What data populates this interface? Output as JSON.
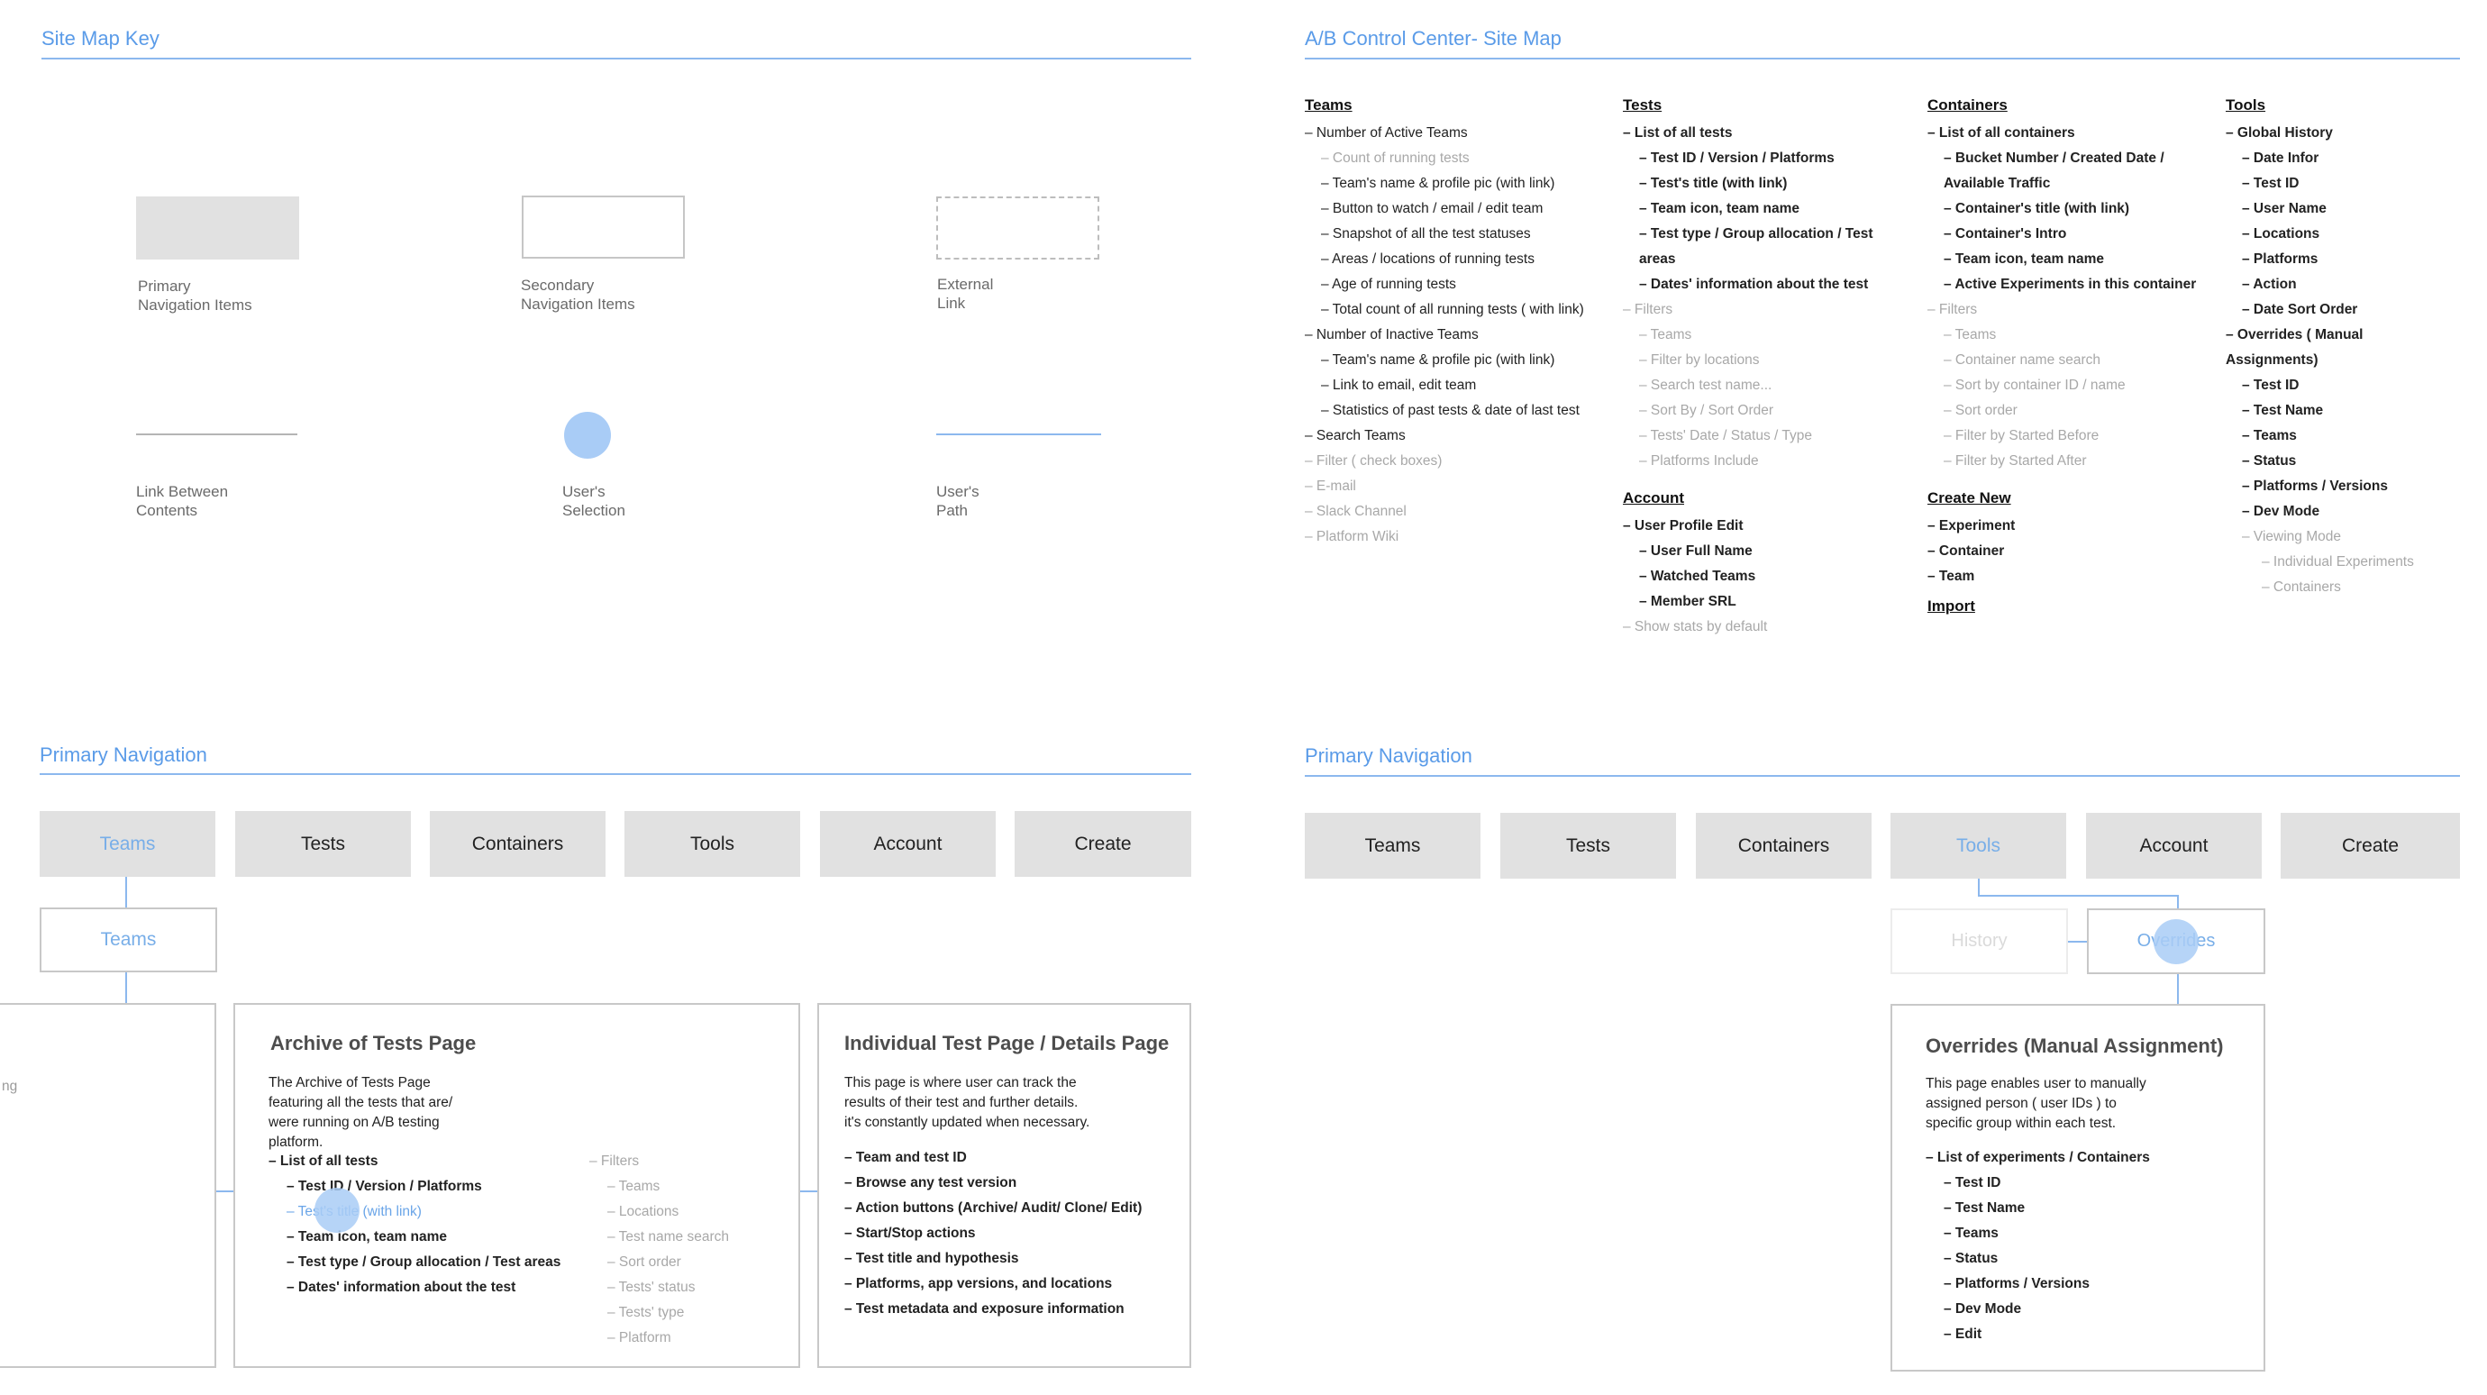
{
  "key": {
    "title": "Site Map Key",
    "primary_l1": "Primary",
    "primary_l2": "Navigation Items",
    "secondary_l1": "Secondary",
    "secondary_l2": "Navigation Items",
    "external_l1": "External",
    "external_l2": "Link",
    "link_l1": "Link Between",
    "link_l2": "Contents",
    "selection_l1": "User's",
    "selection_l2": "Selection",
    "path_l1": "User's",
    "path_l2": "Path"
  },
  "sitemap": {
    "title": "A/B Control Center- Site Map",
    "teams": {
      "heading": "Teams",
      "items": [
        "– Number of Active Teams",
        "– Count of running tests",
        "– Team's name & profile pic (with link)",
        "– Button to watch / email / edit team",
        "– Snapshot of all the test statuses",
        "– Areas / locations of running tests",
        "– Age of running tests",
        "– Total count of all running tests ( with link)",
        "– Number of Inactive Teams",
        "– Team's name & profile pic (with link)",
        "– Link to email, edit team",
        "– Statistics of past tests & date of last test",
        "– Search Teams",
        "– Filter ( check boxes)",
        "– E-mail",
        "– Slack Channel",
        "– Platform Wiki"
      ]
    },
    "tests": {
      "heading": "Tests",
      "items": [
        "– List of all tests",
        "– Test ID / Version / Platforms",
        "– Test's title (with link)",
        "– Team icon, team name",
        "– Test type / Group allocation / Test areas",
        "– Dates' information about the test",
        "– Filters",
        "– Teams",
        "– Filter by locations",
        "– Search test name...",
        "– Sort By / Sort Order",
        "– Tests' Date / Status / Type",
        "– Platforms Include"
      ]
    },
    "account": {
      "heading": "Account",
      "items": [
        "– User Profile Edit",
        "– User Full Name",
        "– Watched Teams",
        "– Member SRL",
        "– Show stats by default"
      ]
    },
    "containers": {
      "heading": "Containers",
      "items": [
        "– List of all containers",
        "– Bucket Number / Created Date / Available Traffic",
        "– Container's title (with link)",
        "– Container's Intro",
        "– Team icon, team name",
        "– Active Experiments in this container",
        "– Filters",
        "– Teams",
        "– Container name search",
        "– Sort by container ID / name",
        "– Sort order",
        "– Filter by Started Before",
        "– Filter by Started After"
      ]
    },
    "create": {
      "heading": "Create New",
      "items": [
        "– Experiment",
        "– Container",
        "– Team"
      ]
    },
    "import": {
      "heading": "Import"
    },
    "tools": {
      "heading": "Tools",
      "items": [
        "– Global History",
        "– Date Infor",
        "– Test ID",
        "– User Name",
        "– Locations",
        "– Platforms",
        "– Action",
        "– Date Sort Order",
        "– Overrides ( Manual Assignments)",
        "– Test ID",
        "– Test Name",
        "– Teams",
        "– Status",
        "– Platforms / Versions",
        "– Dev Mode",
        "– Viewing Mode",
        "– Individual Experiments",
        "– Containers"
      ]
    }
  },
  "nav_left": {
    "title": "Primary Navigation",
    "buttons": [
      "Teams",
      "Tests",
      "Containers",
      "Tools",
      "Account",
      "Create"
    ],
    "sub": "Teams",
    "partial_text": "ng",
    "archive": {
      "title": "Archive of Tests Page",
      "desc": [
        "The Archive of Tests Page",
        "featuring all the tests that are/",
        "were running on A/B testing",
        "platform."
      ],
      "items": [
        "– List of all tests",
        "– Test ID / Version / Platforms",
        "– Test's title (with link)",
        "– Team icon, team name",
        "– Test type / Group allocation / Test areas",
        "– Dates' information about the test"
      ],
      "filters": [
        "– Filters",
        "– Teams",
        "– Locations",
        "– Test name search",
        "– Sort order",
        "– Tests' status",
        "– Tests' type",
        "– Platform"
      ]
    },
    "detail": {
      "title": "Individual Test Page / Details Page",
      "desc": [
        "This page is where user can track the",
        "results of their test and further details.",
        "it's constantly updated when necessary."
      ],
      "items": [
        "– Team and test ID",
        "– Browse any test version",
        "– Action buttons (Archive/ Audit/ Clone/ Edit)",
        "– Start/Stop actions",
        "– Test title and hypothesis",
        "– Platforms, app versions, and locations",
        "– Test metadata and exposure information"
      ]
    }
  },
  "nav_right": {
    "title": "Primary Navigation",
    "buttons": [
      "Teams",
      "Tests",
      "Containers",
      "Tools",
      "Account",
      "Create"
    ],
    "history": "History",
    "overrides": "Overrides",
    "card": {
      "title": "Overrides (Manual Assignment)",
      "desc": [
        "This page enables user to manually",
        "assigned person ( user IDs ) to",
        "specific group within each test."
      ],
      "items": [
        "– List of experiments / Containers",
        "– Test ID",
        "– Test Name",
        "– Teams",
        "– Status",
        "– Platforms / Versions",
        "– Dev Mode",
        "– Edit"
      ]
    }
  },
  "colors": {
    "accent": "#5a9be8",
    "nav_bg": "#e1e1e1",
    "selection": "#a9ccf6",
    "muted": "#a8a8a8"
  }
}
